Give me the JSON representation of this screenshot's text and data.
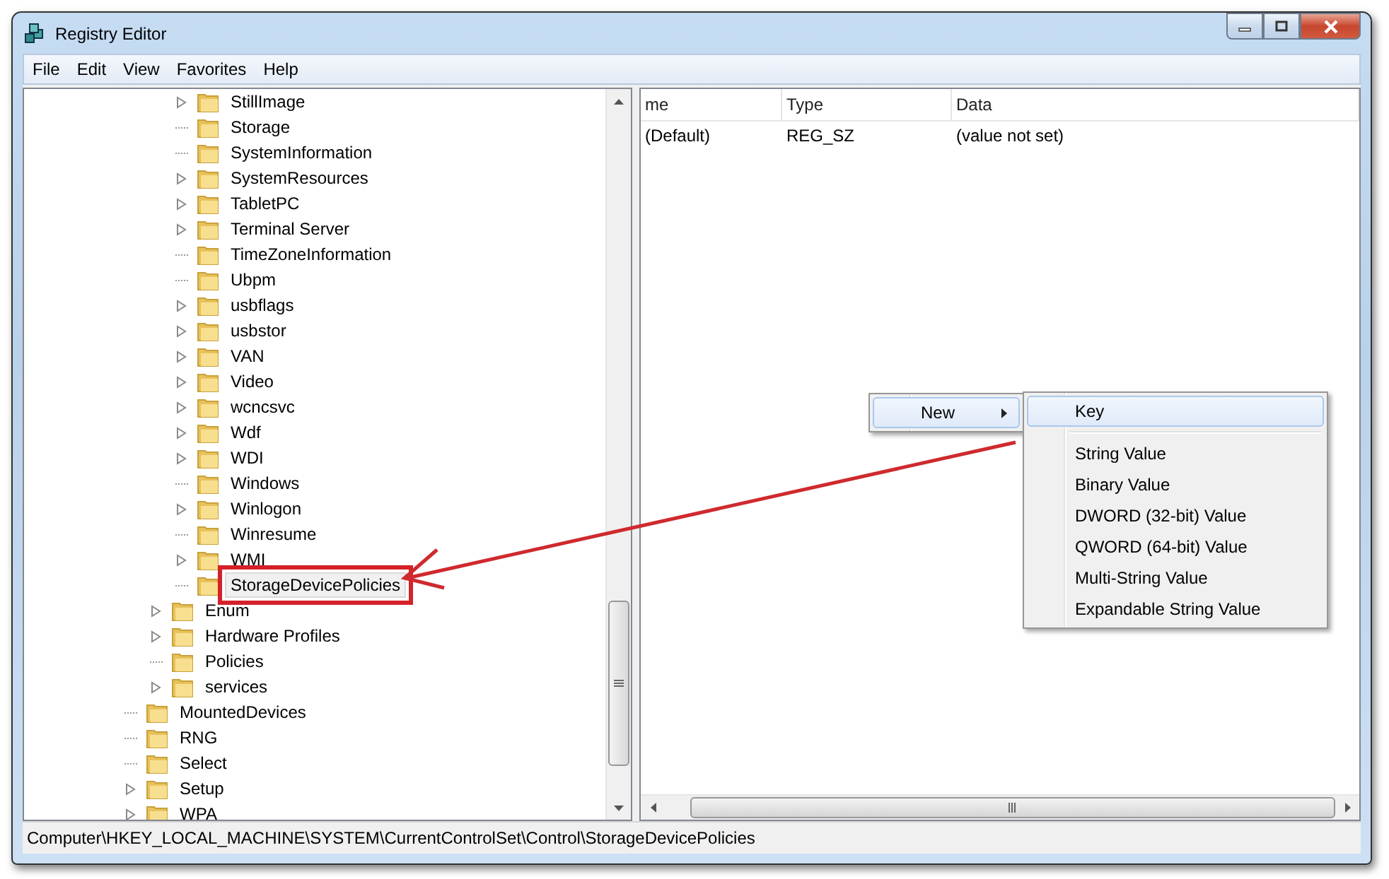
{
  "window": {
    "title": "Registry Editor"
  },
  "menu_bar": [
    {
      "label": "File"
    },
    {
      "label": "Edit"
    },
    {
      "label": "View"
    },
    {
      "label": "Favorites"
    },
    {
      "label": "Help"
    }
  ],
  "tree": [
    {
      "children": [
        {
          "children": [
            {
              "label": "StillImage",
              "expandable": true,
              "selected": false,
              "annotated": false
            },
            {
              "label": "Storage",
              "expandable": false,
              "selected": false,
              "annotated": false
            },
            {
              "label": "SystemInformation",
              "expandable": false,
              "selected": false,
              "annotated": false
            },
            {
              "label": "SystemResources",
              "expandable": true,
              "selected": false,
              "annotated": false
            },
            {
              "label": "TabletPC",
              "expandable": true,
              "selected": false,
              "annotated": false
            },
            {
              "label": "Terminal Server",
              "expandable": true,
              "selected": false,
              "annotated": false
            },
            {
              "label": "TimeZoneInformation",
              "expandable": false,
              "selected": false,
              "annotated": false
            },
            {
              "label": "Ubpm",
              "expandable": false,
              "selected": false,
              "annotated": false
            },
            {
              "label": "usbflags",
              "expandable": true,
              "selected": false,
              "annotated": false
            },
            {
              "label": "usbstor",
              "expandable": true,
              "selected": false,
              "annotated": false
            },
            {
              "label": "VAN",
              "expandable": true,
              "selected": false,
              "annotated": false
            },
            {
              "label": "Video",
              "expandable": true,
              "selected": false,
              "annotated": false
            },
            {
              "label": "wcncsvc",
              "expandable": true,
              "selected": false,
              "annotated": false
            },
            {
              "label": "Wdf",
              "expandable": true,
              "selected": false,
              "annotated": false
            },
            {
              "label": "WDI",
              "expandable": true,
              "selected": false,
              "annotated": false
            },
            {
              "label": "Windows",
              "expandable": false,
              "selected": false,
              "annotated": false
            },
            {
              "label": "Winlogon",
              "expandable": true,
              "selected": false,
              "annotated": false
            },
            {
              "label": "Winresume",
              "expandable": false,
              "selected": false,
              "annotated": false
            },
            {
              "label": "WMI",
              "expandable": true,
              "selected": false,
              "annotated": false
            },
            {
              "label": "StorageDevicePolicies",
              "expandable": false,
              "selected": true,
              "annotated": true
            }
          ]
        },
        {
          "label": "Enum",
          "expandable": true,
          "selected": false,
          "annotated": false
        },
        {
          "label": "Hardware Profiles",
          "expandable": true,
          "selected": false,
          "annotated": false
        },
        {
          "label": "Policies",
          "expandable": false,
          "selected": false,
          "annotated": false
        },
        {
          "label": "services",
          "expandable": true,
          "selected": false,
          "annotated": false
        }
      ]
    },
    {
      "label": "MountedDevices",
      "expandable": false,
      "selected": false,
      "annotated": false
    },
    {
      "label": "RNG",
      "expandable": false,
      "selected": false,
      "annotated": false
    },
    {
      "label": "Select",
      "expandable": false,
      "selected": false,
      "annotated": false
    },
    {
      "label": "Setup",
      "expandable": true,
      "selected": false,
      "annotated": false
    },
    {
      "label": "WPA",
      "expandable": true,
      "selected": false,
      "annotated": false
    }
  ],
  "values_list": {
    "columns": [
      "me",
      "Type",
      "Data"
    ],
    "rows": [
      {
        "cells": [
          "(Default)",
          "REG_SZ",
          "(value not set)"
        ]
      }
    ]
  },
  "context_menu": {
    "items": [
      {
        "label": "New",
        "has_submenu": true,
        "selected": true
      }
    ]
  },
  "submenu": {
    "items": [
      {
        "kind": "item",
        "label": "Key",
        "selected": true
      },
      {
        "kind": "separator"
      },
      {
        "kind": "item",
        "label": "String Value",
        "selected": false
      },
      {
        "kind": "item",
        "label": "Binary Value",
        "selected": false
      },
      {
        "kind": "item",
        "label": "DWORD (32-bit) Value",
        "selected": false
      },
      {
        "kind": "item",
        "label": "QWORD (64-bit) Value",
        "selected": false
      },
      {
        "kind": "item",
        "label": "Multi-String Value",
        "selected": false
      },
      {
        "kind": "item",
        "label": "Expandable String Value",
        "selected": false
      }
    ]
  },
  "status_bar": "Computer\\HKEY_LOCAL_MACHINE\\SYSTEM\\CurrentControlSet\\Control\\StorageDevicePolicies"
}
